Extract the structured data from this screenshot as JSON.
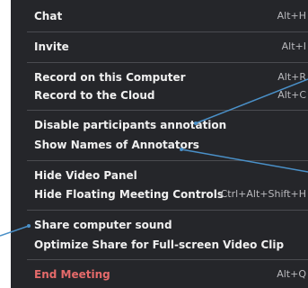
{
  "menu": {
    "items": [
      {
        "label": "Chat",
        "shortcut": "Alt+H"
      },
      {
        "label": "Invite",
        "shortcut": "Alt+I"
      },
      {
        "label": "Record on this Computer",
        "shortcut": "Alt+R"
      },
      {
        "label": "Record to the Cloud",
        "shortcut": "Alt+C"
      },
      {
        "label": "Disable participants annotation",
        "shortcut": ""
      },
      {
        "label": "Show Names of Annotators",
        "shortcut": ""
      },
      {
        "label": "Hide Video Panel",
        "shortcut": ""
      },
      {
        "label": "Hide Floating Meeting Controls",
        "shortcut": "Ctrl+Alt+Shift+H"
      },
      {
        "label": "Share computer sound",
        "shortcut": ""
      },
      {
        "label": "Optimize Share for Full-screen Video Clip",
        "shortcut": ""
      },
      {
        "label": "End Meeting",
        "shortcut": "Alt+Q"
      }
    ]
  },
  "colors": {
    "menu_bg": "#25262a",
    "text": "#f0f0f0",
    "shortcut": "#b9b9bd",
    "separator": "#4a4b50",
    "end_meeting": "#e56a6a",
    "annotation_line": "#4a90c8"
  }
}
